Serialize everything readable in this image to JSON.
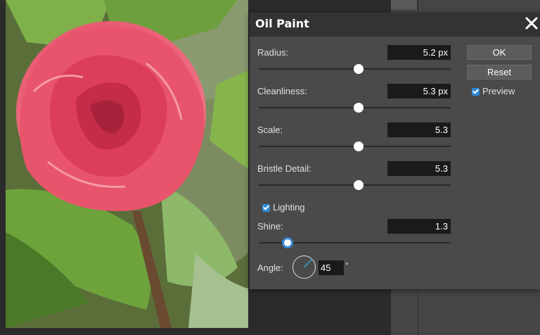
{
  "dialog": {
    "title": "Oil Paint",
    "close_icon": "close-icon"
  },
  "params": {
    "radius": {
      "label": "Radius:",
      "value": "5.2 px",
      "slider_fraction": 0.52
    },
    "cleanliness": {
      "label": "Cleanliness:",
      "value": "5.3 px",
      "slider_fraction": 0.52
    },
    "scale": {
      "label": "Scale:",
      "value": "5.3",
      "slider_fraction": 0.52
    },
    "bristle_detail": {
      "label": "Bristle Detail:",
      "value": "5.3",
      "slider_fraction": 0.52
    },
    "shine": {
      "label": "Shine:",
      "value": "1.3",
      "slider_fraction": 0.15
    },
    "angle": {
      "label": "Angle:",
      "value": "45",
      "unit": "°"
    }
  },
  "lighting": {
    "label": "Lighting",
    "checked": true
  },
  "preview": {
    "label": "Preview",
    "checked": true
  },
  "buttons": {
    "ok": "OK",
    "reset": "Reset"
  },
  "colors": {
    "accent": "#3a86d6",
    "dialog_bg": "#4a4a4a",
    "titlebar_bg": "#333333",
    "field_bg": "#1a1a1a"
  }
}
